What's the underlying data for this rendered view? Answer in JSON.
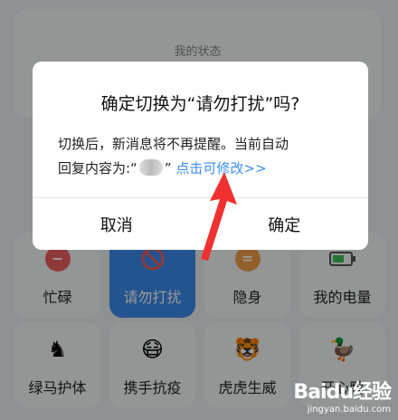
{
  "status_header": {
    "title": "我的状态"
  },
  "tiles": [
    {
      "label": "忙碌",
      "icon": "minus-circle-icon"
    },
    {
      "label": "请勿打扰",
      "icon": "no-entry-icon",
      "active": true
    },
    {
      "label": "隐身",
      "icon": "equals-circle-icon"
    },
    {
      "label": "我的电量",
      "icon": "battery-icon"
    },
    {
      "label": "绿马护体",
      "icon": "green-horse-icon"
    },
    {
      "label": "携手抗疫",
      "icon": "masked-face-icon"
    },
    {
      "label": "虎虎生威",
      "icon": "tiger-icon"
    },
    {
      "label": "开心鸭",
      "icon": "duck-icon"
    }
  ],
  "dialog": {
    "title": "确定切换为“请勿打扰”吗?",
    "body_line1": "切换后，新消息将不再提醒。当前自动",
    "body_line2_prefix": "回复内容为:“",
    "body_line2_suffix": "”",
    "modify_link": "点击可修改>>",
    "cancel_label": "取消",
    "confirm_label": "确定"
  },
  "watermark": {
    "logo": "Baidu经验",
    "url": "jingyan.baidu.com"
  },
  "colors": {
    "accent": "#3d8ef0",
    "active_tile": "#3c8cf0",
    "arrow": "#f03030"
  }
}
